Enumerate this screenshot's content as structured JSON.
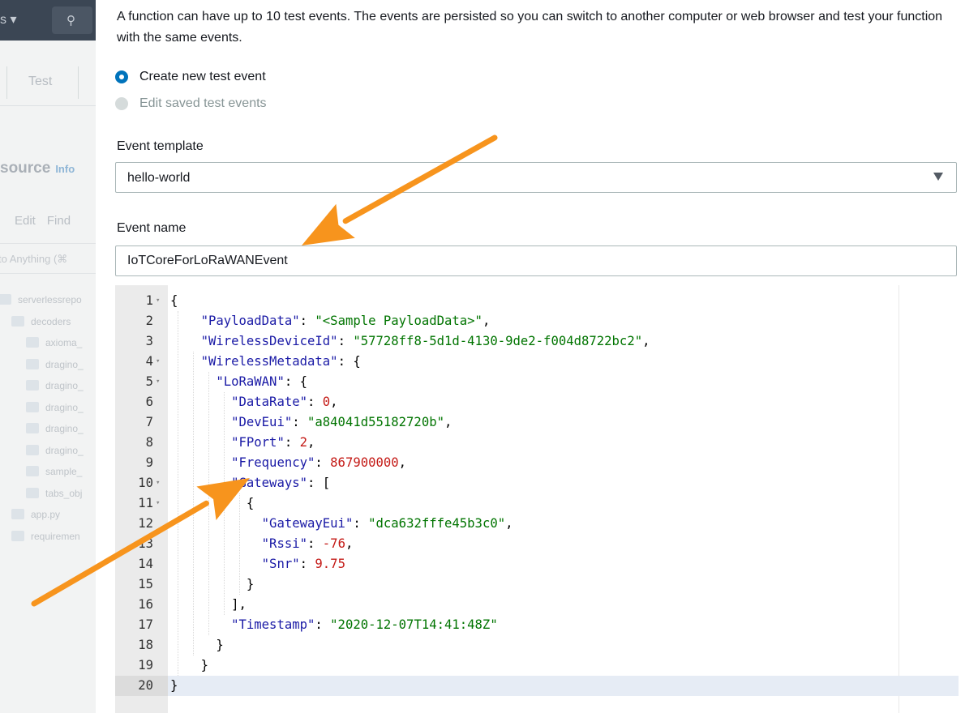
{
  "background": {
    "region_label": "s ▾",
    "tab_label": "Test",
    "section_title": "source",
    "section_info": "Info",
    "menu": [
      "Edit",
      "Find"
    ],
    "goto_placeholder": "to Anything (⌘",
    "tree": [
      {
        "indent": 0,
        "label": "serverlessrepo"
      },
      {
        "indent": 1,
        "label": "decoders"
      },
      {
        "indent": 2,
        "label": "axioma_"
      },
      {
        "indent": 2,
        "label": "dragino_"
      },
      {
        "indent": 2,
        "label": "dragino_"
      },
      {
        "indent": 2,
        "label": "dragino_"
      },
      {
        "indent": 2,
        "label": "dragino_"
      },
      {
        "indent": 2,
        "label": "dragino_"
      },
      {
        "indent": 2,
        "label": "sample_"
      },
      {
        "indent": 2,
        "label": "tabs_obj"
      },
      {
        "indent": 1,
        "label": "app.py"
      },
      {
        "indent": 1,
        "label": "requiremen"
      }
    ]
  },
  "panel": {
    "description": "A function can have up to 10 test events. The events are persisted so you can switch to another computer or web browser and test your function with the same events.",
    "radio_options": [
      {
        "label": "Create new test event",
        "selected": true,
        "disabled": false
      },
      {
        "label": "Edit saved test events",
        "selected": false,
        "disabled": true
      }
    ],
    "event_template_label": "Event template",
    "event_template_value": "hello-world",
    "event_name_label": "Event name",
    "event_name_value": "IoTCoreForLoRaWANEvent"
  },
  "editor": {
    "active_line": 20,
    "lines": [
      {
        "n": "1",
        "fold": true,
        "indent": 0,
        "tokens": [
          [
            "p",
            "{"
          ]
        ]
      },
      {
        "n": "2",
        "fold": false,
        "indent": 2,
        "tokens": [
          [
            "k",
            "\"PayloadData\""
          ],
          [
            "p",
            ": "
          ],
          [
            "s",
            "\"<Sample PayloadData>\""
          ],
          [
            "p",
            ","
          ]
        ]
      },
      {
        "n": "3",
        "fold": false,
        "indent": 2,
        "tokens": [
          [
            "k",
            "\"WirelessDeviceId\""
          ],
          [
            "p",
            ": "
          ],
          [
            "s",
            "\"57728ff8-5d1d-4130-9de2-f004d8722bc2\""
          ],
          [
            "p",
            ","
          ]
        ]
      },
      {
        "n": "4",
        "fold": true,
        "indent": 2,
        "tokens": [
          [
            "k",
            "\"WirelessMetadata\""
          ],
          [
            "p",
            ": {"
          ]
        ]
      },
      {
        "n": "5",
        "fold": true,
        "indent": 3,
        "tokens": [
          [
            "k",
            "\"LoRaWAN\""
          ],
          [
            "p",
            ": {"
          ]
        ]
      },
      {
        "n": "6",
        "fold": false,
        "indent": 4,
        "tokens": [
          [
            "k",
            "\"DataRate\""
          ],
          [
            "p",
            ": "
          ],
          [
            "n",
            "0"
          ],
          [
            "p",
            ","
          ]
        ]
      },
      {
        "n": "7",
        "fold": false,
        "indent": 4,
        "tokens": [
          [
            "k",
            "\"DevEui\""
          ],
          [
            "p",
            ": "
          ],
          [
            "s",
            "\"a84041d55182720b\""
          ],
          [
            "p",
            ","
          ]
        ]
      },
      {
        "n": "8",
        "fold": false,
        "indent": 4,
        "tokens": [
          [
            "k",
            "\"FPort\""
          ],
          [
            "p",
            ": "
          ],
          [
            "n",
            "2"
          ],
          [
            "p",
            ","
          ]
        ]
      },
      {
        "n": "9",
        "fold": false,
        "indent": 4,
        "tokens": [
          [
            "k",
            "\"Frequency\""
          ],
          [
            "p",
            ": "
          ],
          [
            "n",
            "867900000"
          ],
          [
            "p",
            ","
          ]
        ]
      },
      {
        "n": "10",
        "fold": true,
        "indent": 4,
        "tokens": [
          [
            "k",
            "\"Gateways\""
          ],
          [
            "p",
            ": ["
          ]
        ]
      },
      {
        "n": "11",
        "fold": true,
        "indent": 5,
        "tokens": [
          [
            "p",
            "{"
          ]
        ]
      },
      {
        "n": "12",
        "fold": false,
        "indent": 6,
        "tokens": [
          [
            "k",
            "\"GatewayEui\""
          ],
          [
            "p",
            ": "
          ],
          [
            "s",
            "\"dca632fffe45b3c0\""
          ],
          [
            "p",
            ","
          ]
        ]
      },
      {
        "n": "13",
        "fold": false,
        "indent": 6,
        "tokens": [
          [
            "k",
            "\"Rssi\""
          ],
          [
            "p",
            ": "
          ],
          [
            "n",
            "-76"
          ],
          [
            "p",
            ","
          ]
        ]
      },
      {
        "n": "14",
        "fold": false,
        "indent": 6,
        "tokens": [
          [
            "k",
            "\"Snr\""
          ],
          [
            "p",
            ": "
          ],
          [
            "n",
            "9.75"
          ]
        ]
      },
      {
        "n": "15",
        "fold": false,
        "indent": 5,
        "tokens": [
          [
            "p",
            "}"
          ]
        ]
      },
      {
        "n": "16",
        "fold": false,
        "indent": 4,
        "tokens": [
          [
            "p",
            "],"
          ]
        ]
      },
      {
        "n": "17",
        "fold": false,
        "indent": 4,
        "tokens": [
          [
            "k",
            "\"Timestamp\""
          ],
          [
            "p",
            ": "
          ],
          [
            "s",
            "\"2020-12-07T14:41:48Z\""
          ]
        ]
      },
      {
        "n": "18",
        "fold": false,
        "indent": 3,
        "tokens": [
          [
            "p",
            "}"
          ]
        ]
      },
      {
        "n": "19",
        "fold": false,
        "indent": 2,
        "tokens": [
          [
            "p",
            "}"
          ]
        ]
      },
      {
        "n": "20",
        "fold": false,
        "indent": 0,
        "tokens": [
          [
            "p",
            "}"
          ]
        ]
      }
    ]
  },
  "annotations": {
    "arrow_color": "#f7941d"
  },
  "colors": {
    "accent": "#0073bb",
    "key": "#1a1aa6",
    "string": "#007400",
    "number": "#c41a16"
  }
}
